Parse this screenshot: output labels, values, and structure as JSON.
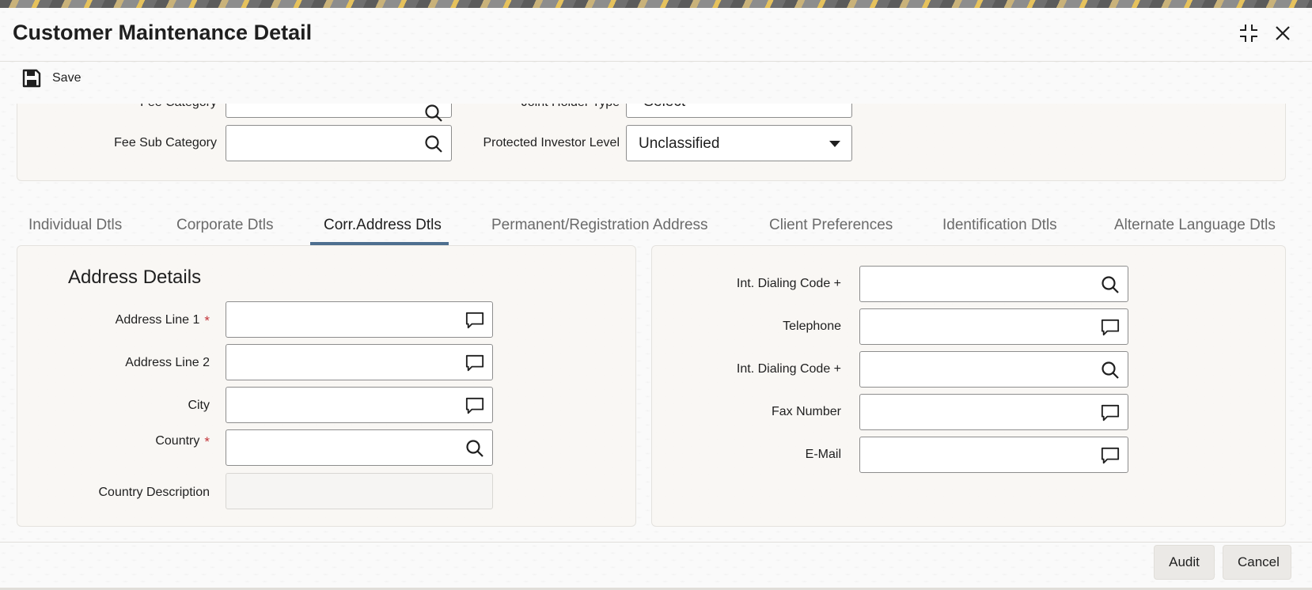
{
  "window": {
    "title": "Customer Maintenance Detail"
  },
  "toolbar": {
    "save_label": "Save"
  },
  "top_panel": {
    "fee_category_label": "Fee Category",
    "joint_holder_type_label": "Joint Holder Type",
    "joint_holder_type_value": "-Select-",
    "fee_sub_category_label": "Fee Sub Category",
    "protected_investor_level_label": "Protected Investor Level",
    "protected_investor_level_value": "Unclassified"
  },
  "tabs": [
    {
      "label": "Individual Dtls",
      "active": false
    },
    {
      "label": "Corporate Dtls",
      "active": false
    },
    {
      "label": "Corr.Address Dtls",
      "active": true
    },
    {
      "label": "Permanent/Registration Address",
      "active": false
    },
    {
      "label": "Client Preferences",
      "active": false
    },
    {
      "label": "Identification Dtls",
      "active": false
    },
    {
      "label": "Alternate Language Dtls",
      "active": false
    }
  ],
  "address_details": {
    "section_title": "Address Details",
    "fields": [
      {
        "label": "Address Line 1",
        "required": "*",
        "icon": "comment-icon"
      },
      {
        "label": "Address Line 2",
        "icon": "comment-icon"
      },
      {
        "label": "City",
        "icon": "comment-icon"
      },
      {
        "label": "Country",
        "required": "*",
        "icon": "search-icon"
      },
      {
        "label": "Country Description",
        "readonly": true
      }
    ]
  },
  "contact_details": {
    "fields": [
      {
        "label": "Int. Dialing Code +",
        "icon": "search-icon"
      },
      {
        "label": "Telephone",
        "icon": "comment-icon"
      },
      {
        "label": "Int. Dialing Code +",
        "icon": "search-icon"
      },
      {
        "label": "Fax Number",
        "icon": "comment-icon"
      },
      {
        "label": "E-Mail",
        "icon": "comment-icon"
      }
    ]
  },
  "footer": {
    "audit_label": "Audit",
    "cancel_label": "Cancel"
  },
  "colors": {
    "active_tab_underline": "#4e6f8f",
    "required_marker": "#c3353a",
    "input_border": "#8d8d8d"
  }
}
